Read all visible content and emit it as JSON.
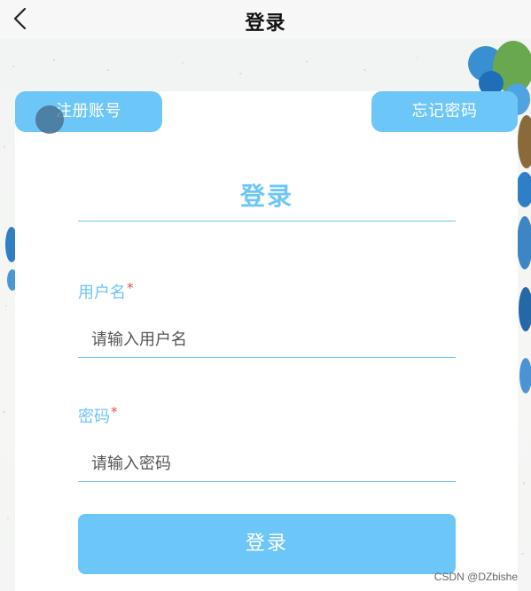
{
  "navbar": {
    "back_icon": "chevron-left-icon",
    "title": "登录"
  },
  "buttons": {
    "register_label": "注册账号",
    "forgot_label": "忘记密码"
  },
  "form": {
    "title": "登录",
    "username": {
      "label": "用户名",
      "required_mark": "*",
      "placeholder": "请输入用户名",
      "value": ""
    },
    "password": {
      "label": "密码",
      "required_mark": "*",
      "placeholder": "请输入密码",
      "value": ""
    },
    "submit_label": "登录"
  },
  "watermark": "CSDN @DZbishe",
  "colors": {
    "accent": "#6cc6f7",
    "required": "#e0505a",
    "card": "#ffffff",
    "navbar": "#f7f7f7"
  }
}
